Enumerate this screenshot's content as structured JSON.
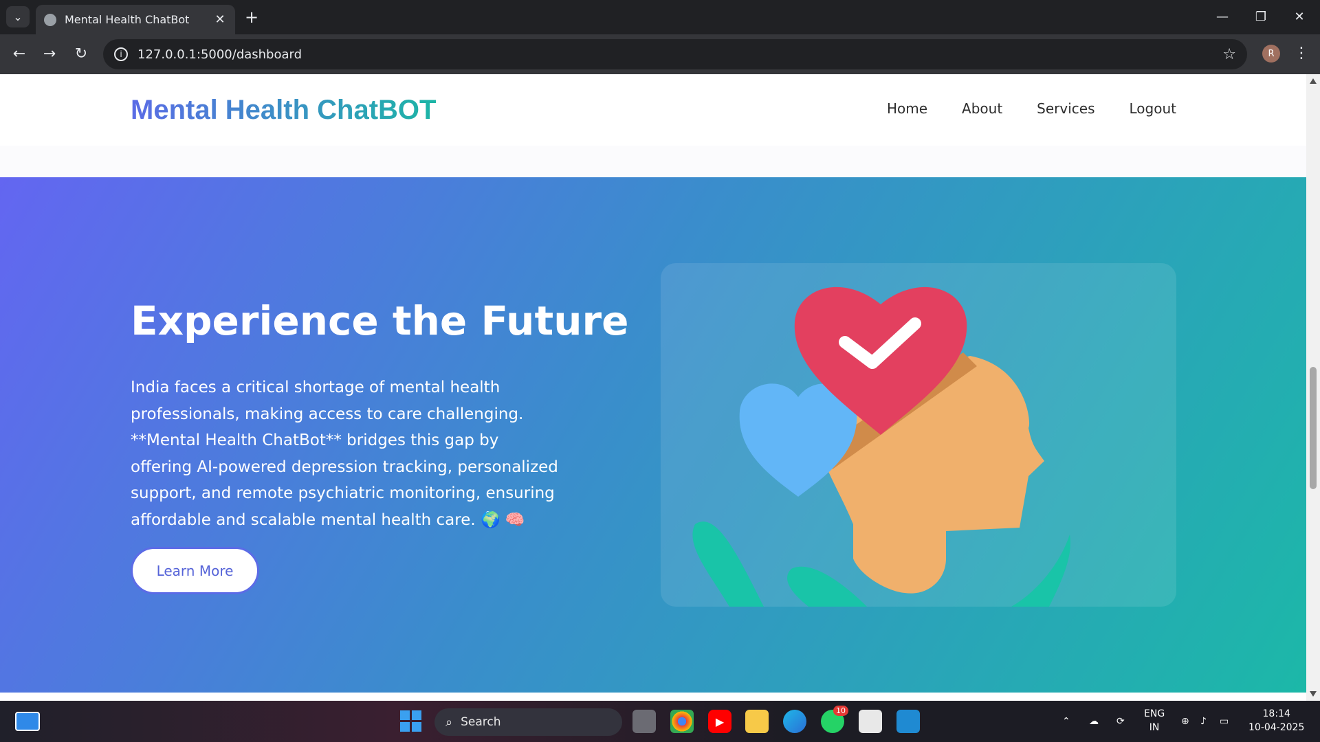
{
  "browser": {
    "tab_title": "Mental Health ChatBot",
    "url": "127.0.0.1:5000/dashboard",
    "profile_initial": "R"
  },
  "site": {
    "logo": "Mental Health ChatBOT",
    "nav": [
      "Home",
      "About",
      "Services",
      "Logout"
    ]
  },
  "hero": {
    "title": "Experience the Future",
    "body": "India faces a critical shortage of mental health professionals, making access to care challenging. **Mental Health ChatBot** bridges this gap by offering AI-powered depression tracking, personalized support, and remote psychiatric monitoring, ensuring affordable and scalable mental health care. 🌍 🧠",
    "cta": "Learn More"
  },
  "taskbar": {
    "search_placeholder": "Search",
    "whatsapp_badge": "10",
    "lang_top": "ENG",
    "lang_bottom": "IN",
    "time": "18:14",
    "date": "10-04-2025"
  },
  "colors": {
    "hero_gradient_start": "#6366f1",
    "hero_gradient_end": "#1cb8a8",
    "heart_red": "#e3405f",
    "heart_blue": "#62b6f7",
    "head_orange": "#f0b06c"
  }
}
